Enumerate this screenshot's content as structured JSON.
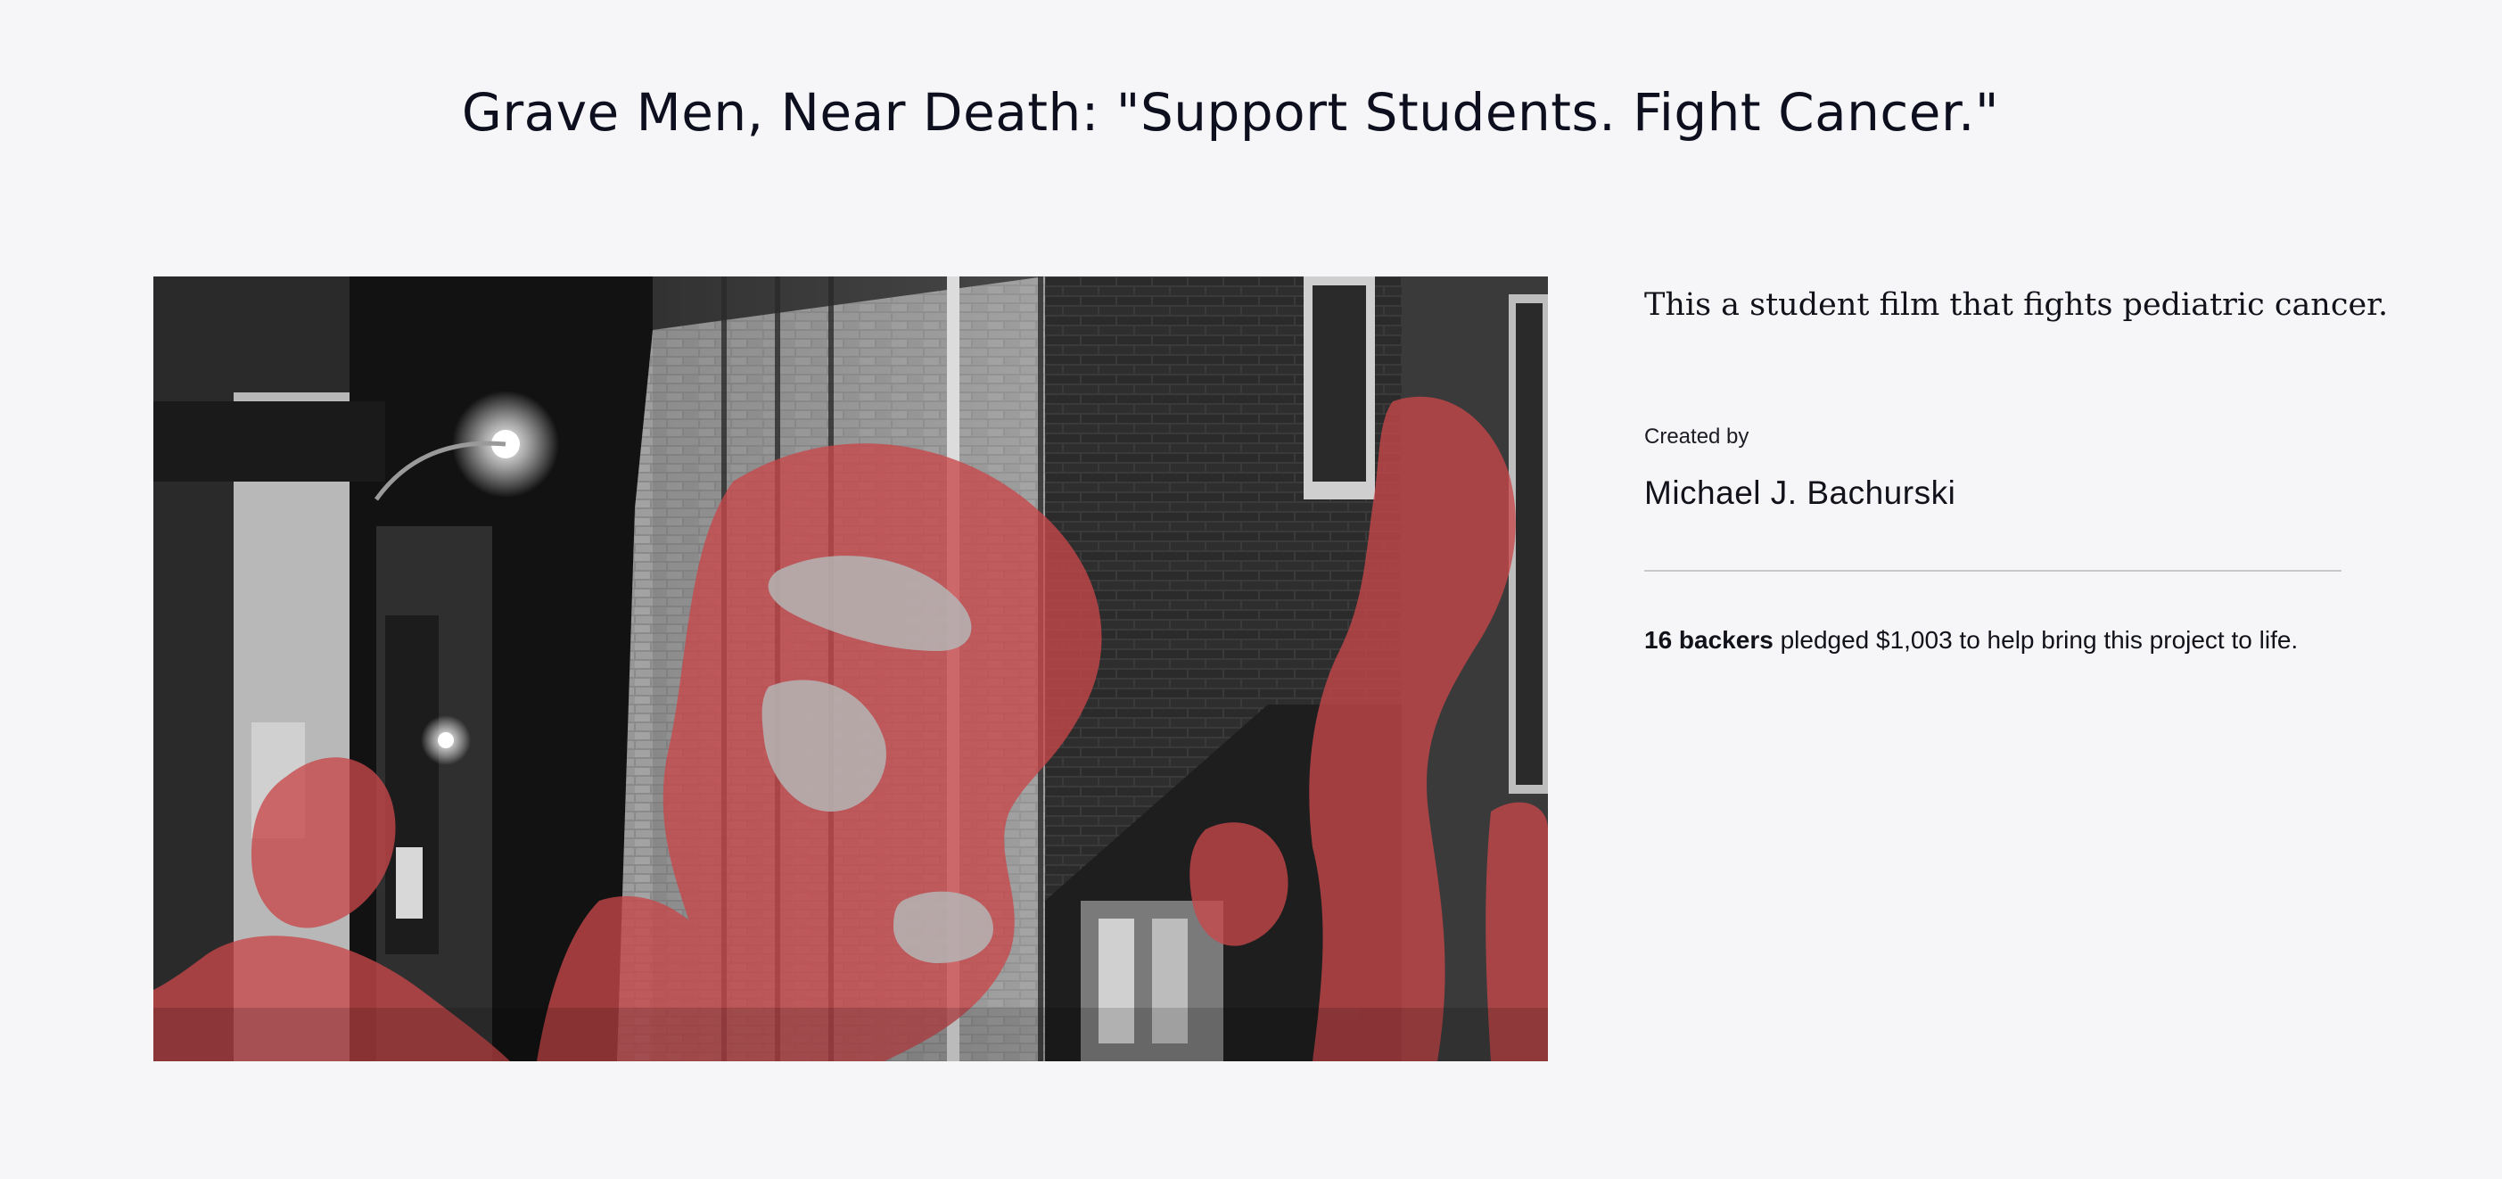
{
  "project": {
    "title": "Grave Men, Near Death: \"Support Students. Fight Cancer.\"",
    "blurb": "This a student film that fights pediatric cancer.",
    "created_by_label": "Created by",
    "creator": "Michael J. Bachurski",
    "backers_count": "16 backers",
    "pledge_text": " pledged $1,003 to help bring this project to life."
  },
  "colors": {
    "background": "#f6f6f8",
    "text": "#11121a",
    "accent_red": "#c8474a",
    "divider": "#c8c8cc"
  }
}
